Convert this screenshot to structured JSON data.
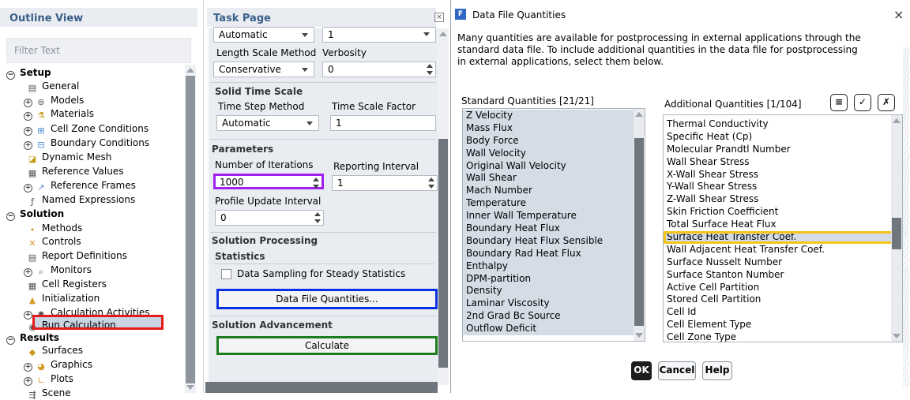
{
  "outline": {
    "title": "Outline View",
    "filter_placeholder": "Filter Text",
    "tree": [
      {
        "label": "Setup",
        "expander": "⊖",
        "icon": "",
        "bold": true
      },
      {
        "label": "General",
        "expander": "",
        "icon": "general-icon"
      },
      {
        "label": "Models",
        "expander": "⊕",
        "icon": "models-icon"
      },
      {
        "label": "Materials",
        "expander": "⊕",
        "icon": "materials-icon"
      },
      {
        "label": "Cell Zone Conditions",
        "expander": "⊕",
        "icon": "cell-zone-icon"
      },
      {
        "label": "Boundary Conditions",
        "expander": "⊕",
        "icon": "boundary-icon"
      },
      {
        "label": "Dynamic Mesh",
        "expander": "",
        "icon": "dynamic-mesh-icon"
      },
      {
        "label": "Reference Values",
        "expander": "",
        "icon": "reference-values-icon"
      },
      {
        "label": "Reference Frames",
        "expander": "⊕",
        "icon": "reference-frames-icon"
      },
      {
        "label": "Named Expressions",
        "expander": "",
        "icon": "named-expressions-icon"
      },
      {
        "label": "Solution",
        "expander": "⊖",
        "icon": "",
        "bold": true
      },
      {
        "label": "Methods",
        "expander": "",
        "icon": "methods-icon"
      },
      {
        "label": "Controls",
        "expander": "",
        "icon": "controls-icon"
      },
      {
        "label": "Report Definitions",
        "expander": "",
        "icon": "report-definitions-icon"
      },
      {
        "label": "Monitors",
        "expander": "⊕",
        "icon": "monitors-icon"
      },
      {
        "label": "Cell Registers",
        "expander": "",
        "icon": "cell-registers-icon"
      },
      {
        "label": "Initialization",
        "expander": "",
        "icon": "initialization-icon"
      },
      {
        "label": "Calculation Activities",
        "expander": "⊕",
        "icon": "calculation-activities-icon"
      },
      {
        "label": "Run Calculation",
        "expander": "",
        "icon": "run-calculation-icon"
      },
      {
        "label": "Results",
        "expander": "⊖",
        "icon": "",
        "bold": true
      },
      {
        "label": "Surfaces",
        "expander": "",
        "icon": "surfaces-icon"
      },
      {
        "label": "Graphics",
        "expander": "⊕",
        "icon": "graphics-icon"
      },
      {
        "label": "Plots",
        "expander": "⊕",
        "icon": "plots-icon"
      },
      {
        "label": "Scene",
        "expander": "",
        "icon": "scene-icon"
      }
    ]
  },
  "task": {
    "title": "Task Page",
    "top_select_value": "Automatic",
    "top_number_value": "1",
    "length_scale_method_label": "Length Scale Method",
    "verbosity_label": "Verbosity",
    "length_scale_method_value": "Conservative",
    "verbosity_value": "0",
    "solid_time_scale_title": "Solid Time Scale",
    "time_step_method_label": "Time Step Method",
    "time_scale_factor_label": "Time Scale Factor",
    "time_step_method_value": "Automatic",
    "time_scale_factor_value": "1",
    "parameters_title": "Parameters",
    "number_of_iterations_label": "Number of Iterations",
    "reporting_interval_label": "Reporting Interval",
    "number_of_iterations_value": "1000",
    "reporting_interval_value": "1",
    "profile_update_interval_label": "Profile Update Interval",
    "profile_update_interval_value": "0",
    "solution_processing_title": "Solution Processing",
    "statistics_title": "Statistics",
    "data_sampling_label": "Data Sampling for Steady Statistics",
    "data_file_quantities_button": "Data File Quantities...",
    "solution_advancement_title": "Solution Advancement",
    "calculate_button": "Calculate",
    "highlight_colors": {
      "iterations": "#a020f0",
      "data_file": "#0a2fe0",
      "calculate": "#1b7d1b",
      "run_calc": "#e41b1b",
      "selected_item": "#f5c518"
    }
  },
  "dialog": {
    "title": "Data File Quantities",
    "icon_letter": "F",
    "close_glyph": "×",
    "description": "Many quantities are available for postprocessing in external applications through the standard data file. To include additional quantities in the data file for postprocessing in external applications, select them below.",
    "standard_caption": "Standard Quantities [21/21]",
    "standard_items": [
      "Z Velocity",
      "Mass Flux",
      "Body Force",
      "Wall Velocity",
      "Original Wall Velocity",
      "Wall Shear",
      "Mach Number",
      "Temperature",
      "Inner Wall Temperature",
      "Boundary Heat Flux",
      "Boundary Heat Flux Sensible",
      "Boundary Rad Heat Flux",
      "Enthalpy",
      "DPM-partition",
      "Density",
      "Laminar Viscosity",
      "2nd Grad Bc Source",
      "Outflow Deficit"
    ],
    "additional_caption": "Additional Quantities [1/104]",
    "additional_items": [
      "Thermal Conductivity",
      "Specific Heat (Cp)",
      "Molecular Prandtl Number",
      "Wall Shear Stress",
      "X-Wall Shear Stress",
      "Y-Wall Shear Stress",
      "Z-Wall Shear Stress",
      "Skin Friction Coefficient",
      "Total Surface Heat Flux",
      "Surface Heat Transfer Coef.",
      "Wall Adjacent Heat Transfer Coef.",
      "Surface Nusselt Number",
      "Surface Stanton Number",
      "Active Cell Partition",
      "Stored Cell Partition",
      "Cell Id",
      "Cell Element Type",
      "Cell Zone Type"
    ],
    "selected_additional": "Surface Heat Transfer Coef.",
    "buttons": {
      "ok": "OK",
      "cancel": "Cancel",
      "help": "Help"
    }
  }
}
